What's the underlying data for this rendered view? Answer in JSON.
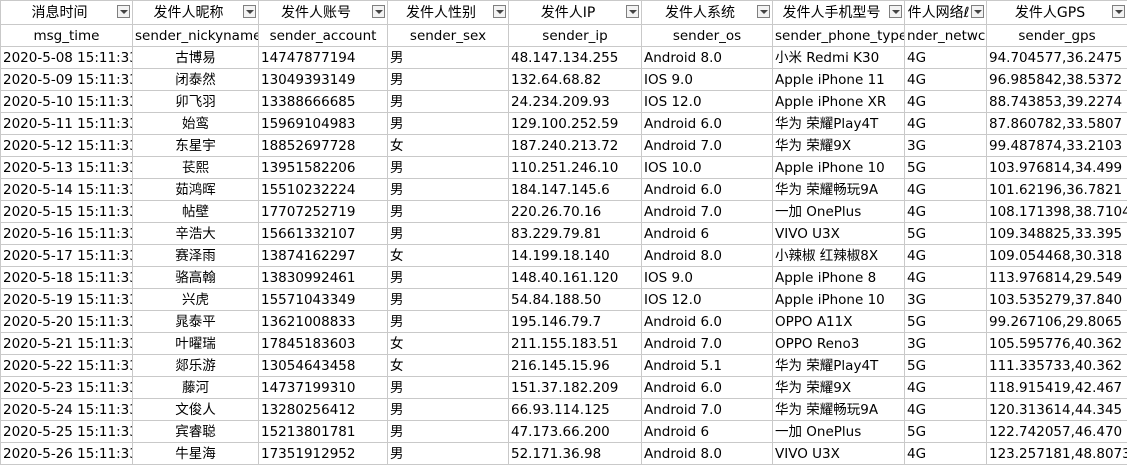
{
  "headers": [
    {
      "cn": "消息时间",
      "en": "msg_time"
    },
    {
      "cn": "发件人昵称",
      "en": "sender_nickyname"
    },
    {
      "cn": "发件人账号",
      "en": "sender_account"
    },
    {
      "cn": "发件人性别",
      "en": "sender_sex"
    },
    {
      "cn": "发件人IP",
      "en": "sender_ip"
    },
    {
      "cn": "发件人系统",
      "en": "sender_os"
    },
    {
      "cn": "发件人手机型号",
      "en": "sender_phone_type"
    },
    {
      "cn": "件人网络ℓ",
      "en": "nder_netwc"
    },
    {
      "cn": "发件人GPS",
      "en": "sender_gps"
    }
  ],
  "rows": [
    [
      "2020-5-08 15:11:33",
      "古博易",
      "14747877194",
      "男",
      "48.147.134.255",
      "Android 8.0",
      "小米 Redmi K30",
      "4G",
      "94.704577,36.2475"
    ],
    [
      "2020-5-09 15:11:33",
      "闭泰然",
      "13049393149",
      "男",
      "132.64.68.82",
      "IOS 9.0",
      "Apple iPhone 11",
      "4G",
      "96.985842,38.5372"
    ],
    [
      "2020-5-10 15:11:33",
      "卯飞羽",
      "13388666685",
      "男",
      "24.234.209.93",
      "IOS 12.0",
      "Apple iPhone XR",
      "4G",
      "88.743853,39.2274"
    ],
    [
      "2020-5-11 15:11:33",
      "始鸾",
      "15969104983",
      "男",
      "129.100.252.59",
      "Android 6.0",
      "华为 荣耀Play4T",
      "4G",
      "87.860782,33.5807"
    ],
    [
      "2020-5-12 15:11:33",
      "东星宇",
      "18852697728",
      "女",
      "187.240.213.72",
      "Android 7.0",
      "华为 荣耀9X",
      "3G",
      "99.487874,33.2103"
    ],
    [
      "2020-5-13 15:11:33",
      "苌熙",
      "13951582206",
      "男",
      "110.251.246.10",
      "IOS 10.0",
      "Apple iPhone 10",
      "5G",
      "103.976814,34.499"
    ],
    [
      "2020-5-14 15:11:33",
      "茹鸿晖",
      "15510232224",
      "男",
      "184.147.145.6",
      "Android 6.0",
      "华为 荣耀畅玩9A",
      "4G",
      "101.62196,36.7821"
    ],
    [
      "2020-5-15 15:11:33",
      "帖壁",
      "17707252719",
      "男",
      "220.26.70.16",
      "Android 7.0",
      "一加 OnePlus",
      "4G",
      "108.171398,38.7104"
    ],
    [
      "2020-5-16 15:11:33",
      "辛浩大",
      "15661332107",
      "男",
      "83.229.79.81",
      "Android 6",
      "VIVO U3X",
      "5G",
      "109.348825,33.395"
    ],
    [
      "2020-5-17 15:11:33",
      "赛泽雨",
      "13874162297",
      "女",
      "14.199.18.140",
      "Android 8.0",
      "小辣椒 红辣椒8X",
      "4G",
      "109.054468,30.318"
    ],
    [
      "2020-5-18 15:11:33",
      "骆高翰",
      "13830992461",
      "男",
      "148.40.161.120",
      "IOS 9.0",
      "Apple iPhone 8",
      "4G",
      "113.976814,29.549"
    ],
    [
      "2020-5-19 15:11:33",
      "兴虎",
      "15571043349",
      "男",
      "54.84.188.50",
      "IOS 12.0",
      "Apple iPhone 10",
      "3G",
      "103.535279,37.840"
    ],
    [
      "2020-5-20 15:11:33",
      "晁泰平",
      "13621008833",
      "男",
      "195.146.79.7",
      "Android 6.0",
      "OPPO A11X",
      "5G",
      "99.267106,29.8065"
    ],
    [
      "2020-5-21 15:11:33",
      "叶曜瑞",
      "17845183603",
      "女",
      "211.155.183.51",
      "Android 7.0",
      "OPPO Reno3",
      "3G",
      "105.595776,40.362"
    ],
    [
      "2020-5-22 15:11:33",
      "郯乐游",
      "13054643458",
      "女",
      "216.145.15.96",
      "Android 5.1",
      "华为 荣耀Play4T",
      "5G",
      "111.335733,40.362"
    ],
    [
      "2020-5-23 15:11:33",
      "藤河",
      "14737199310",
      "男",
      "151.37.182.209",
      "Android 6.0",
      "华为 荣耀9X",
      "4G",
      "118.915419,42.467"
    ],
    [
      "2020-5-24 15:11:33",
      "文俊人",
      "13280256412",
      "男",
      "66.93.114.125",
      "Android 7.0",
      "华为 荣耀畅玩9A",
      "4G",
      "120.313614,44.345"
    ],
    [
      "2020-5-25 15:11:33",
      "宾睿聪",
      "15213801781",
      "男",
      "47.173.66.200",
      "Android 6",
      "一加 OnePlus",
      "5G",
      "122.742057,46.470"
    ],
    [
      "2020-5-26 15:11:33",
      "牛星海",
      "17351912952",
      "男",
      "52.171.36.98",
      "Android 8.0",
      "VIVO U3X",
      "4G",
      "123.257181,48.8073"
    ]
  ]
}
